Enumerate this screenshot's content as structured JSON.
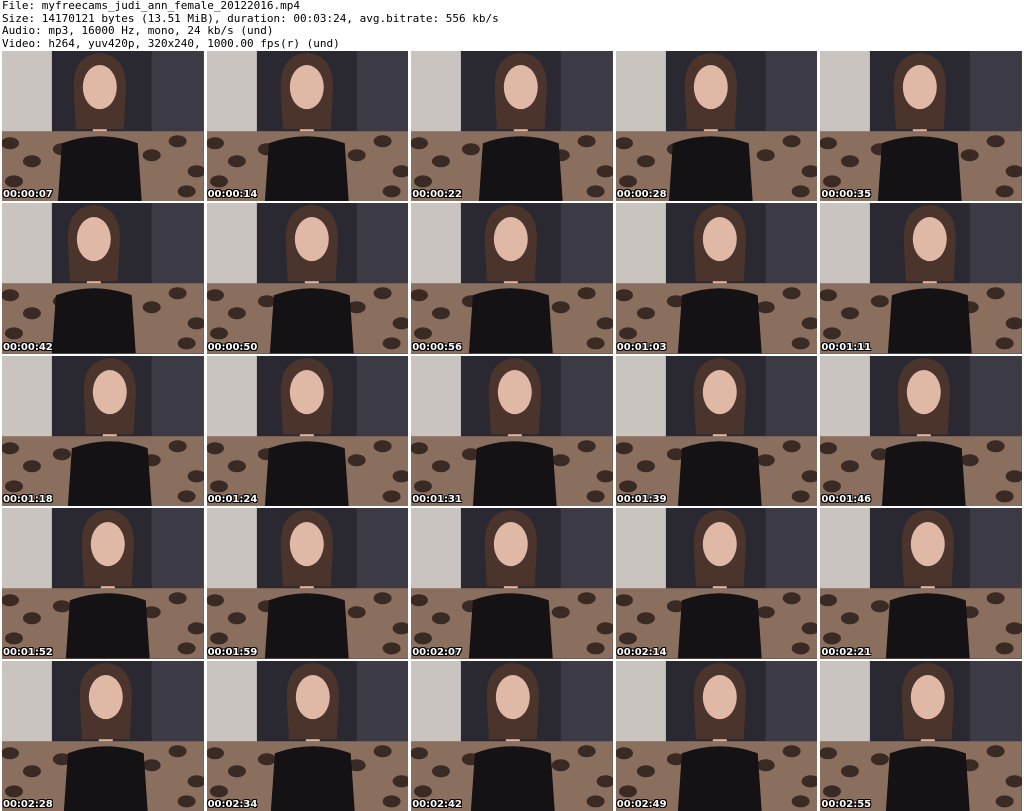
{
  "header": {
    "file_line": "File: myfreecams_judi_ann_female_20122016.mp4",
    "size_line": "Size: 14170121 bytes (13.51 MiB), duration: 00:03:24, avg.bitrate: 556 kb/s",
    "audio_line": "Audio: mp3, 16000 Hz, mono, 24 kb/s (und)",
    "video_line": "Video: h264, yuv420p, 320x240, 1000.00 fps(r) (und)"
  },
  "thumbnails": [
    {
      "timestamp": "00:00:07"
    },
    {
      "timestamp": "00:00:14"
    },
    {
      "timestamp": "00:00:22"
    },
    {
      "timestamp": "00:00:28"
    },
    {
      "timestamp": "00:00:35"
    },
    {
      "timestamp": "00:00:42"
    },
    {
      "timestamp": "00:00:50"
    },
    {
      "timestamp": "00:00:56"
    },
    {
      "timestamp": "00:01:03"
    },
    {
      "timestamp": "00:01:11"
    },
    {
      "timestamp": "00:01:18"
    },
    {
      "timestamp": "00:01:24"
    },
    {
      "timestamp": "00:01:31"
    },
    {
      "timestamp": "00:01:39"
    },
    {
      "timestamp": "00:01:46"
    },
    {
      "timestamp": "00:01:52"
    },
    {
      "timestamp": "00:01:59"
    },
    {
      "timestamp": "00:02:07"
    },
    {
      "timestamp": "00:02:14"
    },
    {
      "timestamp": "00:02:21"
    },
    {
      "timestamp": "00:02:28"
    },
    {
      "timestamp": "00:02:34"
    },
    {
      "timestamp": "00:02:42"
    },
    {
      "timestamp": "00:02:49"
    },
    {
      "timestamp": "00:02:55"
    }
  ],
  "colors": {
    "curtain_light": "#c9c4c0",
    "curtain_dark": "#2a2830",
    "sofa": "#8a6e5e",
    "sofa_spot": "#3a2a24",
    "skin": "#e0b8a6",
    "hair": "#4a342c",
    "top": "#141214"
  }
}
